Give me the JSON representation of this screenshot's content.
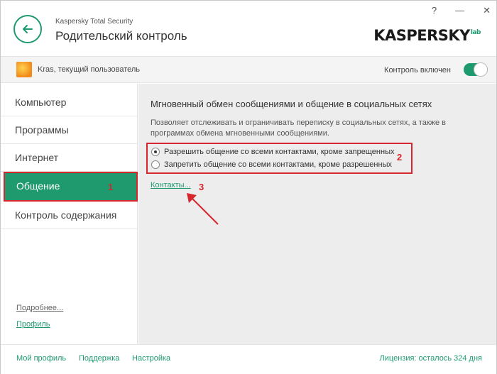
{
  "header": {
    "app_name": "Kaspersky Total Security",
    "title": "Родительский контроль",
    "help": "?",
    "minimize": "—",
    "close": "✕",
    "logo": "KASPERSKY",
    "logo_lab": "lab"
  },
  "userbar": {
    "user_label": "Kras, текущий пользователь",
    "control_label": "Контроль включен",
    "control_on": true
  },
  "sidebar": {
    "items": [
      {
        "label": "Компьютер"
      },
      {
        "label": "Программы"
      },
      {
        "label": "Интернет"
      },
      {
        "label": "Общение"
      },
      {
        "label": "Контроль содержания"
      }
    ],
    "active_index": 3,
    "more_link": "Подробнее...",
    "profile_link": "Профиль"
  },
  "content": {
    "title": "Мгновенный обмен сообщениями и общение в социальных сетях",
    "description": "Позволяет отслеживать и ограничивать переписку в социальных сетях, а также в программах обмена мгновенными сообщениями.",
    "radio_options": [
      {
        "label": "Разрешить общение со всеми контактами, кроме запрещенных",
        "checked": true
      },
      {
        "label": "Запретить общение со всеми контактами, кроме разрешенных",
        "checked": false
      }
    ],
    "contacts_link": "Контакты..."
  },
  "annotations": {
    "marker_1": "1",
    "marker_2": "2",
    "marker_3": "3",
    "color": "#d7262e"
  },
  "footer": {
    "my_profile": "Мой профиль",
    "support": "Поддержка",
    "settings": "Настройка",
    "license": "Лицензия: осталось 324 дня"
  },
  "colors": {
    "accent": "#1f9a6e",
    "highlight": "#d7262e"
  }
}
